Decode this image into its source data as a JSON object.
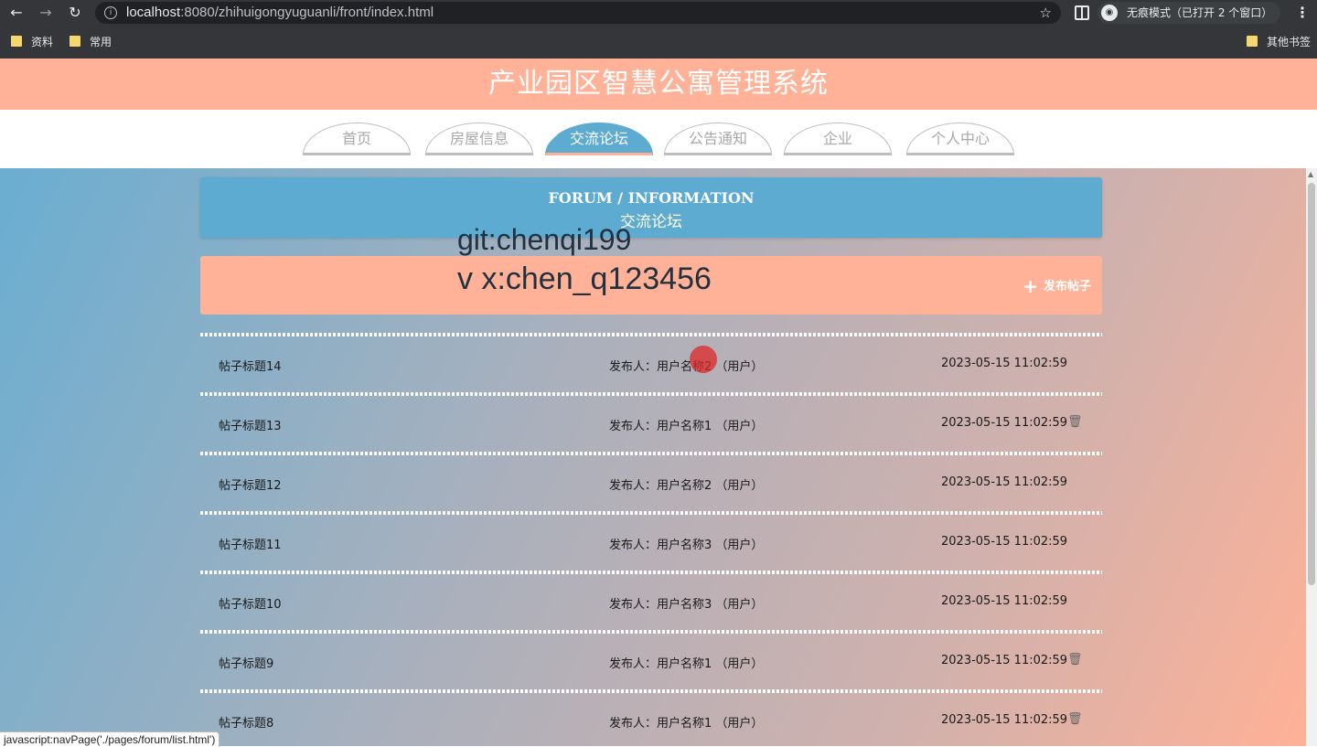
{
  "browser": {
    "url_host": "localhost",
    "url_rest": ":8080/zhihuigongyuguanli/front/index.html",
    "incognito_label": "无痕模式（已打开 2 个窗口）",
    "bookmarks": [
      "资料",
      "常用"
    ],
    "other_bookmarks": "其他书签",
    "status_text": "javascript:navPage('./pages/forum/list.html')"
  },
  "header": {
    "title": "产业园区智慧公寓管理系统"
  },
  "nav": {
    "tabs": [
      {
        "label": "首页",
        "active": false
      },
      {
        "label": "房屋信息",
        "active": false
      },
      {
        "label": "交流论坛",
        "active": true
      },
      {
        "label": "公告通知",
        "active": false
      },
      {
        "label": "企业",
        "active": false
      },
      {
        "label": "个人中心",
        "active": false
      }
    ]
  },
  "forum": {
    "title_en": "FORUM / INFORMATION",
    "title_cn": "交流论坛",
    "publish_label": "发布帖子",
    "posts": [
      {
        "title": "帖子标题14",
        "author": "发布人：用户名称2 （用户）",
        "time": "2023-05-15 11:02:59",
        "deletable": false
      },
      {
        "title": "帖子标题13",
        "author": "发布人：用户名称1 （用户）",
        "time": "2023-05-15 11:02:59",
        "deletable": true
      },
      {
        "title": "帖子标题12",
        "author": "发布人：用户名称2 （用户）",
        "time": "2023-05-15 11:02:59",
        "deletable": false
      },
      {
        "title": "帖子标题11",
        "author": "发布人：用户名称3 （用户）",
        "time": "2023-05-15 11:02:59",
        "deletable": false
      },
      {
        "title": "帖子标题10",
        "author": "发布人：用户名称3 （用户）",
        "time": "2023-05-15 11:02:59",
        "deletable": false
      },
      {
        "title": "帖子标题9",
        "author": "发布人：用户名称1 （用户）",
        "time": "2023-05-15 11:02:59",
        "deletable": true
      },
      {
        "title": "帖子标题8",
        "author": "发布人：用户名称1 （用户）",
        "time": "2023-05-15 11:02:59",
        "deletable": true
      }
    ]
  },
  "overlay": {
    "line1": "git:chenqi199",
    "line2": "v x:chen_q123456"
  },
  "colors": {
    "header_bg": "#ffb297",
    "accent_blue": "#5eabd1"
  }
}
